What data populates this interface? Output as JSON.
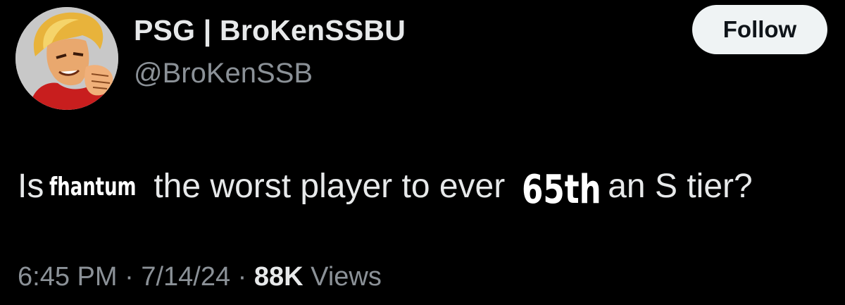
{
  "author": {
    "display_name": "PSG | BroKenSSBU",
    "handle": "@BroKenSSB",
    "avatar_icon": "fighter-portrait-avatar"
  },
  "follow_button": {
    "label": "Follow"
  },
  "tweet": {
    "text_prefix": "Is",
    "overlay_name": "fhantum",
    "text_middle": "the worst player to ever",
    "overlay_rank": "65th",
    "text_suffix": "an S tier?"
  },
  "meta": {
    "time": "6:45 PM",
    "separator": "·",
    "date": "7/14/24",
    "views_count": "88K",
    "views_label": "Views"
  },
  "colors": {
    "background": "#000000",
    "primary_text": "#e7e9ea",
    "secondary_text": "#8b9197",
    "follow_button_bg": "#eff3f4"
  }
}
